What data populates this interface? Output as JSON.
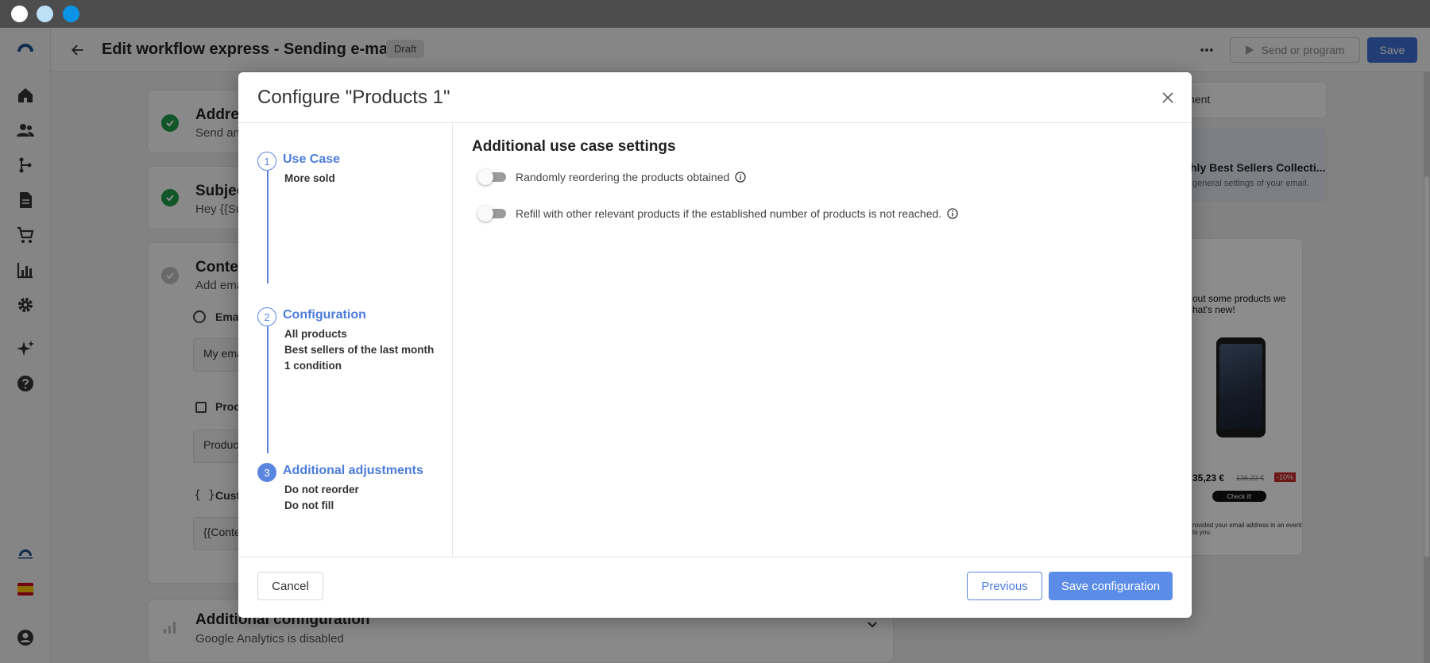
{
  "header": {
    "title": "Edit workflow express - Sending e-mails",
    "badge": "Draft",
    "send_label": "Send or program",
    "save_label": "Save"
  },
  "background": {
    "cards": [
      {
        "title": "Addres",
        "subtitle": "Send an"
      },
      {
        "title": "Subjec",
        "subtitle": "Hey {{Su"
      },
      {
        "title": "Conter",
        "subtitle": "Add ema"
      }
    ],
    "email_label": "Emai",
    "email_value": "My ema",
    "products_label": "Prod",
    "products_value": "Product",
    "custom_label": "Custo",
    "custom_value": "{{Conte",
    "additional_title": "Additional configuration",
    "additional_sub": "Google Analytics is disabled",
    "right_tab": "nent",
    "right_card_title": "hly Best Sellers Collecti...",
    "right_card_sub": "general settings of your email.",
    "preview_text_1": "out some products we",
    "preview_text_2": "hat's new!",
    "preview_price": "35,23 €",
    "preview_old_price": "136,23 €",
    "preview_discount": "-10%",
    "preview_cta": "Check it!",
    "preview_footer_1": "rovided your email address in an event",
    "preview_footer_2": "to you."
  },
  "modal": {
    "title": "Configure \"Products 1\"",
    "steps": [
      {
        "num": "1",
        "title": "Use Case",
        "details": [
          "More sold"
        ]
      },
      {
        "num": "2",
        "title": "Configuration",
        "details": [
          "All products",
          "Best sellers of the last month",
          "1 condition"
        ]
      },
      {
        "num": "3",
        "title": "Additional adjustments",
        "details": [
          "Do not reorder",
          "Do not fill"
        ]
      }
    ],
    "section_title": "Additional use case settings",
    "toggles": [
      {
        "label": "Randomly reordering the products obtained",
        "on": false
      },
      {
        "label": "Refill with other relevant products if the established number of products is not reached.",
        "on": false
      }
    ],
    "cancel_label": "Cancel",
    "previous_label": "Previous",
    "save_label": "Save configuration"
  },
  "colors": {
    "accent": "#5b86e0",
    "primary_button": "#5b8de8",
    "header_save": "#3f6fd1",
    "success": "#1f9d49"
  }
}
